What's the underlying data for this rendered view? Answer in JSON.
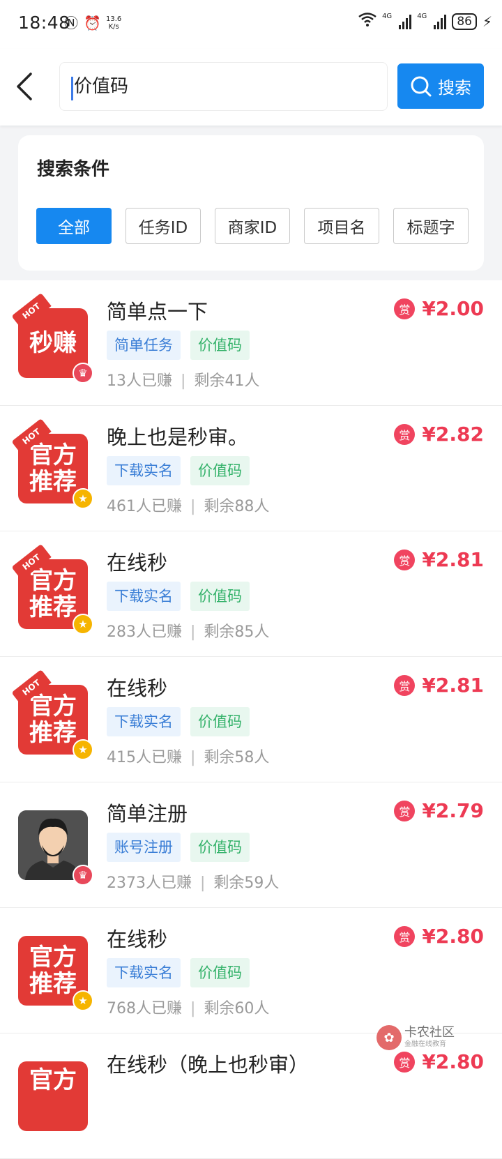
{
  "status": {
    "time": "18:48",
    "net_speed_top": "13.6",
    "net_speed_bottom": "K/s",
    "net_1": "4G",
    "net_2": "4G",
    "battery": "86"
  },
  "header": {
    "search_value": "价值码",
    "search_button": "搜索"
  },
  "conditions": {
    "title": "搜索条件",
    "chips": [
      {
        "label": "全部",
        "active": true
      },
      {
        "label": "任务ID",
        "active": false
      },
      {
        "label": "商家ID",
        "active": false
      },
      {
        "label": "项目名",
        "active": false
      },
      {
        "label": "标题字",
        "active": false
      }
    ]
  },
  "tasks": [
    {
      "title": "简单点一下",
      "tag1": "简单任务",
      "tag2": "价值码",
      "earned": "13人已赚",
      "remaining": "剩余41人",
      "reward_icon": "赏",
      "price": "¥2.00",
      "thumb_line1": "秒赚",
      "thumb_line2": "",
      "hot": "HOT"
    },
    {
      "title": "晚上也是秒审。",
      "tag1": "下载实名",
      "tag2": "价值码",
      "earned": "461人已赚",
      "remaining": "剩余88人",
      "reward_icon": "赏",
      "price": "¥2.82",
      "thumb_line1": "官方",
      "thumb_line2": "推荐",
      "hot": "HOT"
    },
    {
      "title": "在线秒",
      "tag1": "下载实名",
      "tag2": "价值码",
      "earned": "283人已赚",
      "remaining": "剩余85人",
      "reward_icon": "赏",
      "price": "¥2.81",
      "thumb_line1": "官方",
      "thumb_line2": "推荐",
      "hot": "HOT"
    },
    {
      "title": "在线秒",
      "tag1": "下载实名",
      "tag2": "价值码",
      "earned": "415人已赚",
      "remaining": "剩余58人",
      "reward_icon": "赏",
      "price": "¥2.81",
      "thumb_line1": "官方",
      "thumb_line2": "推荐",
      "hot": "HOT"
    },
    {
      "title": "简单注册",
      "tag1": "账号注册",
      "tag2": "价值码",
      "earned": "2373人已赚",
      "remaining": "剩余59人",
      "reward_icon": "赏",
      "price": "¥2.79"
    },
    {
      "title": "在线秒",
      "tag1": "下载实名",
      "tag2": "价值码",
      "earned": "768人已赚",
      "remaining": "剩余60人",
      "reward_icon": "赏",
      "price": "¥2.80",
      "thumb_line1": "官方",
      "thumb_line2": "推荐"
    },
    {
      "title": "在线秒（晚上也秒审）",
      "reward_icon": "赏",
      "price": "¥2.80",
      "thumb_line1": "官方"
    }
  ],
  "watermark": {
    "line1": "卡农社区",
    "line2": "金融在线教育"
  },
  "colors": {
    "accent": "#1688f0",
    "price": "#ed3a53",
    "tag_blue": "#3a7ed6",
    "tag_green": "#34b26a"
  }
}
